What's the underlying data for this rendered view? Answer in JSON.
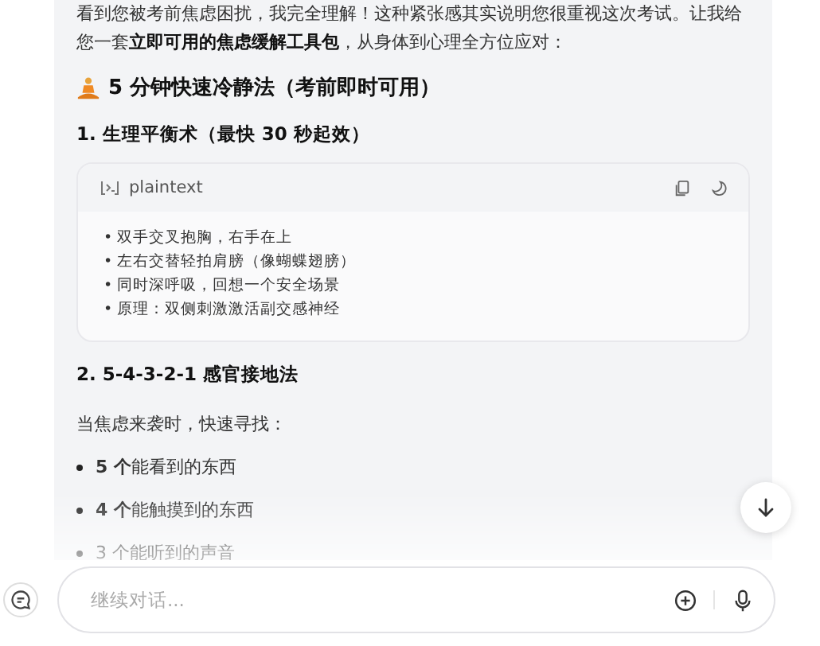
{
  "message": {
    "intro": "看到您被考前焦虑困扰，我完全理解！这种紧张感其实说明您很重视这次考试。让我给您一套**立即可用的焦虑缓解工具包**，从身体到心理全方位应对：",
    "heading": "5 分钟快速冷静法（考前即时可用）",
    "sections": [
      {
        "title": "1. 生理平衡术（最快 30 秒起效）",
        "code": {
          "language": "plaintext",
          "lines": [
            "• 双手交叉抱胸，右手在上",
            "• 左右交替轻拍肩膀（像蝴蝶翅膀）",
            "• 同时深呼吸，回想一个安全场景",
            "• 原理：双侧刺激激活副交感神经"
          ]
        }
      },
      {
        "title": "2. 5-4-3-2-1 感官接地法",
        "text": "当焦虑来袭时，快速寻找：",
        "bullets": [
          "**5 个**能看到的东西",
          "**4 个**能触摸到的东西",
          "3 个能听到的声音"
        ]
      }
    ]
  },
  "composer": {
    "placeholder": "继续对话..."
  }
}
